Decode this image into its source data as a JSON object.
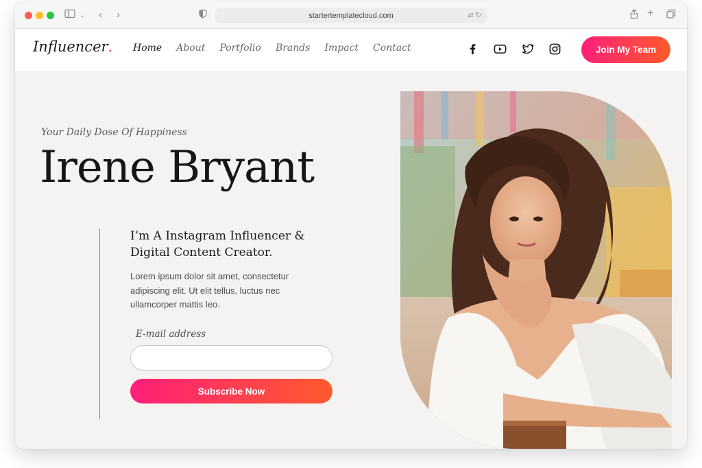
{
  "browser": {
    "url": "startertemplatecloud.com"
  },
  "header": {
    "logo_text": "Influencer",
    "logo_dot": ".",
    "nav": [
      {
        "label": "Home"
      },
      {
        "label": "About"
      },
      {
        "label": "Portfolio"
      },
      {
        "label": "Brands"
      },
      {
        "label": "Impact"
      },
      {
        "label": "Contact"
      }
    ],
    "social_icons": [
      "facebook-icon",
      "youtube-icon",
      "twitter-icon",
      "instagram-icon"
    ],
    "cta_label": "Join My Team"
  },
  "hero": {
    "tagline": "Your Daily Dose Of Happiness",
    "name": "Irene Bryant",
    "subtitle_line1": "I’m A Instagram Influencer &",
    "subtitle_line2": "Digital Content Creator.",
    "description": "Lorem ipsum dolor sit amet, consectetur adipiscing elit. Ut elit tellus, luctus nec ullamcorper mattis leo.",
    "email_label": "E-mail address",
    "email_value": "",
    "subscribe_label": "Subscribe Now"
  },
  "colors": {
    "accent_start": "#ff1f79",
    "accent_end": "#ff5a2c",
    "accent_line": "#f2573a",
    "hero_bg": "#f4f3f2"
  }
}
